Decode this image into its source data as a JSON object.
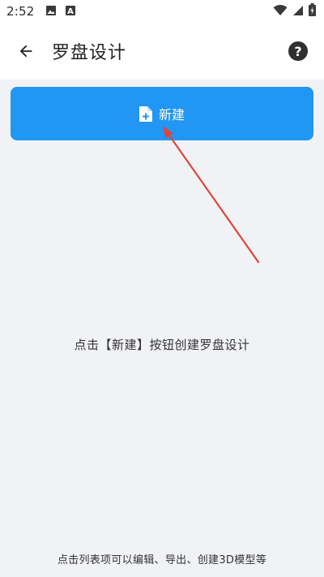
{
  "status_bar": {
    "time": "2:52",
    "left_icons": [
      "image-icon",
      "a-notification-icon"
    ],
    "right_icons": [
      "wifi-icon",
      "signal-icon",
      "battery-icon"
    ]
  },
  "app_bar": {
    "title": "罗盘设计",
    "back_icon": "arrow-left-icon",
    "help_icon": "help-circle-icon",
    "help_glyph": "?"
  },
  "main": {
    "new_button_label": "新建",
    "new_button_icon": "file-plus-icon",
    "empty_hint": "点击【新建】按钮创建罗盘设计",
    "footer_hint": "点击列表项可以编辑、导出、创建3D模型等"
  },
  "colors": {
    "accent": "#2196f3",
    "background": "#f1f2f5",
    "annotation_arrow": "#e0443a"
  }
}
